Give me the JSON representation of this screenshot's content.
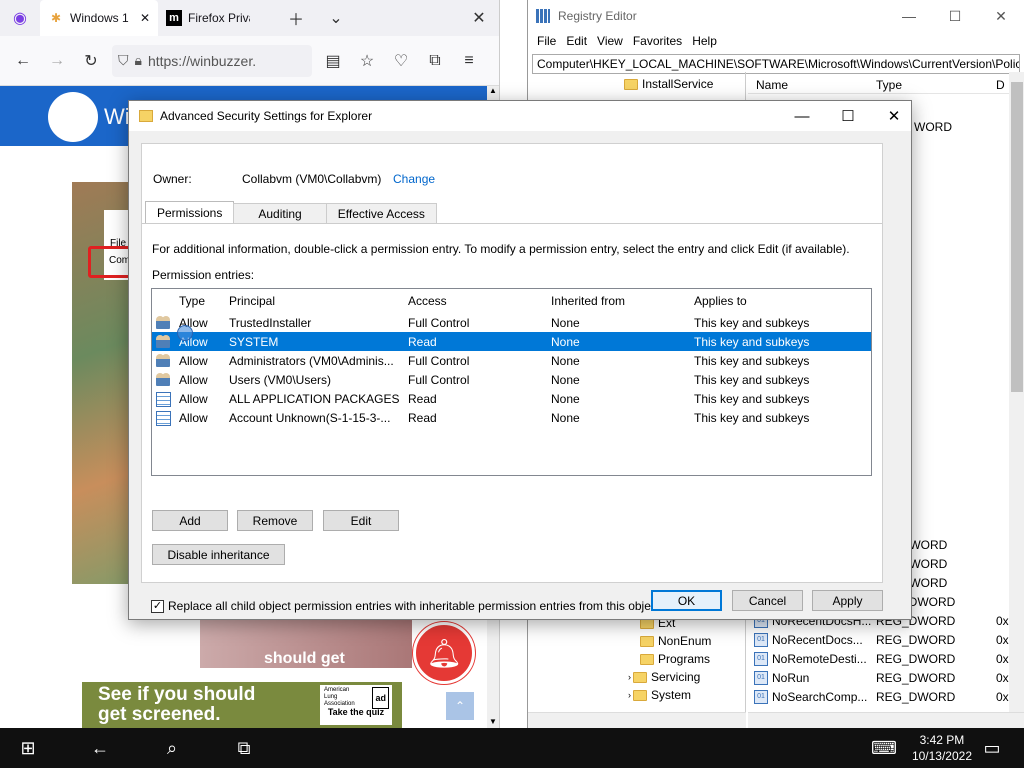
{
  "firefox": {
    "tabs": [
      {
        "label": "Windows 1"
      },
      {
        "label": "Firefox Privac"
      }
    ],
    "url": "https://winbuzzer.",
    "site_letters": "Wi",
    "ad_text_line1": "See if you should",
    "ad_text_line2": "get screened.",
    "ad_brand": "American Lung Association",
    "ad_cta": "Take the quiz",
    "ad_chip": "ad",
    "video_caption": "should get",
    "regedit_small_file": "File",
    "regedit_small_com": "Com"
  },
  "regedit": {
    "title": "Registry Editor",
    "menu": [
      "File",
      "Edit",
      "View",
      "Favorites",
      "Help"
    ],
    "address": "Computer\\HKEY_LOCAL_MACHINE\\SOFTWARE\\Microsoft\\Windows\\CurrentVersion\\Policie",
    "tree_items": [
      "InstallService",
      "Ext",
      "NonEnum",
      "Programs",
      "Servicing",
      "System"
    ],
    "columns": {
      "name": "Name",
      "type": "Type",
      "data": "D"
    },
    "type_fragment": "WORD",
    "values": [
      {
        "name": "NoRecentDocsH...",
        "type": "REG_DWORD",
        "data": "0x"
      },
      {
        "name": "NoRecentDocs...",
        "type": "REG_DWORD",
        "data": "0x"
      },
      {
        "name": "NoRemoteDesti...",
        "type": "REG_DWORD",
        "data": "0x"
      },
      {
        "name": "NoRun",
        "type": "REG_DWORD",
        "data": "0x"
      },
      {
        "name": "NoSearchComp...",
        "type": "REG_DWORD",
        "data": "0x"
      }
    ],
    "extra_types": [
      "_DWORD",
      "_DWORD",
      "_DWORD",
      "REG_DWORD"
    ]
  },
  "dialog": {
    "title": "Advanced Security Settings for Explorer",
    "owner_label": "Owner:",
    "owner_value": "Collabvm (VM0\\Collabvm)",
    "owner_change": "Change",
    "tabs": [
      "Permissions",
      "Auditing",
      "Effective Access"
    ],
    "help_text": "For additional information, double-click a permission entry. To modify a permission entry, select the entry and click Edit (if available).",
    "entries_label": "Permission entries:",
    "columns": [
      "Type",
      "Principal",
      "Access",
      "Inherited from",
      "Applies to"
    ],
    "rows": [
      {
        "type": "Allow",
        "principal": "TrustedInstaller",
        "access": "Full Control",
        "inherited": "None",
        "applies": "This key and subkeys",
        "icon": "user-group-icon"
      },
      {
        "type": "Allow",
        "principal": "SYSTEM",
        "access": "Read",
        "inherited": "None",
        "applies": "This key and subkeys",
        "icon": "user-group-icon"
      },
      {
        "type": "Allow",
        "principal": "Administrators (VM0\\Adminis...",
        "access": "Full Control",
        "inherited": "None",
        "applies": "This key and subkeys",
        "icon": "user-group-icon"
      },
      {
        "type": "Allow",
        "principal": "Users (VM0\\Users)",
        "access": "Full Control",
        "inherited": "None",
        "applies": "This key and subkeys",
        "icon": "user-group-icon"
      },
      {
        "type": "Allow",
        "principal": "ALL APPLICATION PACKAGES",
        "access": "Read",
        "inherited": "None",
        "applies": "This key and subkeys",
        "icon": "package-icon"
      },
      {
        "type": "Allow",
        "principal": "Account Unknown(S-1-15-3-...",
        "access": "Read",
        "inherited": "None",
        "applies": "This key and subkeys",
        "icon": "package-icon"
      }
    ],
    "selected_row": 1,
    "buttons": {
      "add": "Add",
      "remove": "Remove",
      "edit": "Edit",
      "disable_inheritance": "Disable inheritance",
      "ok": "OK",
      "cancel": "Cancel",
      "apply": "Apply"
    },
    "replace_checkbox_label": "Replace all child object permission entries with inheritable permission entries from this object",
    "replace_checked": true
  },
  "taskbar": {
    "time": "3:42 PM",
    "date": "10/13/2022"
  },
  "colors": {
    "accent": "#0078d7",
    "link": "#0066cc",
    "site_header": "#1b66c9",
    "notify": "#e53935"
  }
}
